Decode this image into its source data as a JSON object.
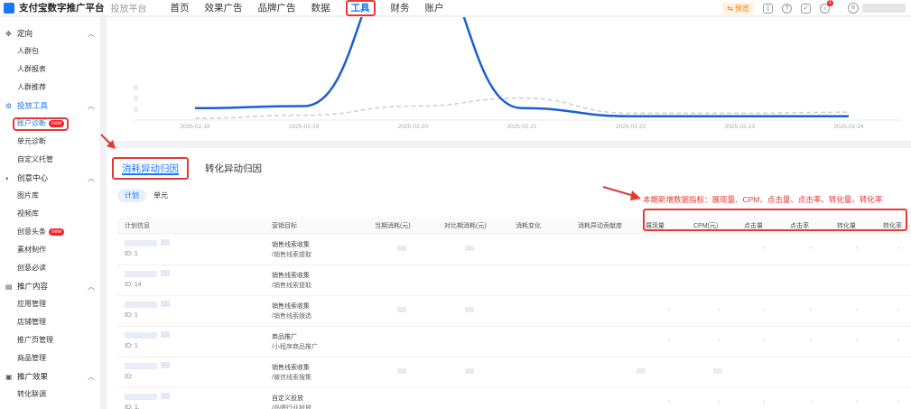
{
  "brand": {
    "name": "支付宝数字推广平台",
    "sub": "投放平台"
  },
  "nav": [
    "首页",
    "效果广告",
    "品牌广告",
    "数据",
    "工具",
    "财务",
    "账户"
  ],
  "nav_active": "工具",
  "top_right": {
    "badge": "预览",
    "bell_count": "1"
  },
  "sidebar": [
    {
      "group": "定向",
      "icon": "target-icon",
      "items": [
        {
          "label": "人群包"
        },
        {
          "label": "人群报表"
        },
        {
          "label": "人群推荐"
        }
      ]
    },
    {
      "group": "投放工具",
      "icon": "tool-icon",
      "active": true,
      "items": [
        {
          "label": "账户诊断",
          "tag": "new",
          "highlight": true
        },
        {
          "label": "单元诊断"
        },
        {
          "label": "自定义托管"
        }
      ]
    },
    {
      "group": "创意中心",
      "icon": "bulb-icon",
      "items": [
        {
          "label": "图片库"
        },
        {
          "label": "视频库"
        },
        {
          "label": "创意头条",
          "tag": "new"
        },
        {
          "label": "素材制作"
        },
        {
          "label": "创意必读"
        }
      ]
    },
    {
      "group": "推广内容",
      "icon": "content-icon",
      "items": [
        {
          "label": "应用管理"
        },
        {
          "label": "店铺管理"
        },
        {
          "label": "推广页管理"
        },
        {
          "label": "商品管理"
        }
      ]
    },
    {
      "group": "推广效果",
      "icon": "effect-icon",
      "items": [
        {
          "label": "转化联调"
        }
      ]
    }
  ],
  "chart_data": {
    "type": "line",
    "x": [
      "2025-02-18",
      "2025-02-19",
      "2025-02-20",
      "2025-02-21",
      "2025-02-22",
      "2025-02-23",
      "2025-02-24"
    ],
    "series": [
      {
        "values": [
          0.1,
          0.12,
          1.7,
          0.1,
          0.02,
          0.02,
          0.02
        ],
        "color": "#1b5fd6"
      },
      {
        "values": [
          0.0,
          0.03,
          0.12,
          0.2,
          0.05,
          0.05,
          0.06
        ],
        "color": "#cfcfcf",
        "dashed": true
      }
    ],
    "grid": false,
    "ylim": [
      0,
      1
    ]
  },
  "tabs": [
    {
      "label": "消耗异动归因",
      "active": true
    },
    {
      "label": "转化异动归因"
    }
  ],
  "segment": [
    {
      "label": "计划",
      "active": true
    },
    {
      "label": "单元"
    }
  ],
  "note": "本期新增数据指标：展现量、CPM、点击量、点击率、转化量、转化率",
  "columns": [
    "计划信息",
    "营销目标",
    "当期消耗(元)",
    "对比期消耗(元)",
    "消耗变化",
    "消耗异动贡献度",
    "展现量",
    "CPM(元)",
    "点击量",
    "点击率",
    "转化量",
    "转化率"
  ],
  "rows": [
    {
      "id": "ID: 1",
      "goal": "销售线索收集",
      "goal_sub": "/销售线索提取"
    },
    {
      "id": "ID: 14",
      "goal": "销售线索收集",
      "goal_sub": "/销售线索提取"
    },
    {
      "id": "ID: 1",
      "goal": "销售线索收集",
      "goal_sub": "/销售线索拨选"
    },
    {
      "id": "ID: 1",
      "goal": "商品推广",
      "goal_sub": "/小程序商品推广"
    },
    {
      "id": "ID:",
      "goal": "销售线索收集",
      "goal_sub": "/微信线索搜集"
    },
    {
      "id": "ID: 1.",
      "goal": "自定义投放",
      "goal_sub": "/品牌行业投放"
    }
  ],
  "dash": "-"
}
